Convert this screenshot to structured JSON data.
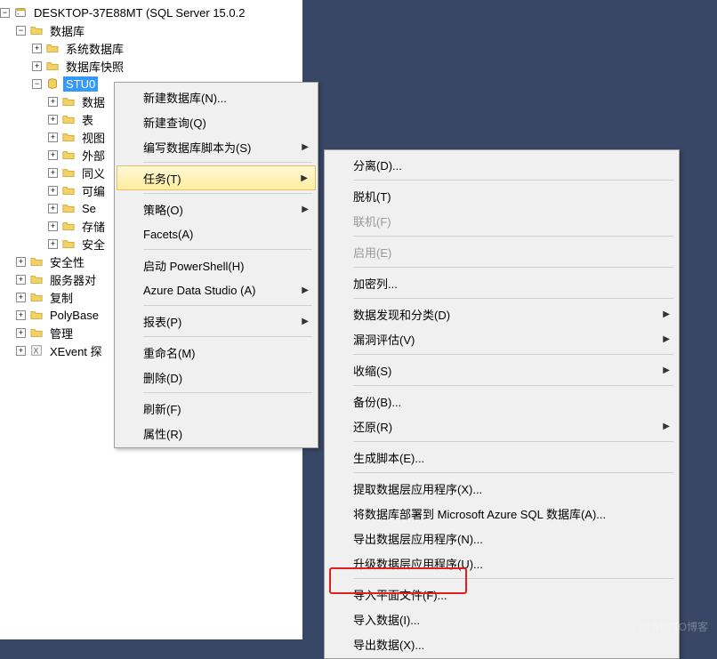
{
  "tree": {
    "root": "DESKTOP-37E88MT (SQL Server 15.0.2",
    "databases": "数据库",
    "sys_db": "系统数据库",
    "snapshot": "数据库快照",
    "selected_db": "STU0",
    "child_diagrams": "数据",
    "child_tables": "表",
    "child_views": "视图",
    "child_ext": "外部",
    "child_syn": "同义",
    "child_prog": "可编",
    "child_sec": "Se",
    "child_store": "存储",
    "child_sec2": "安全",
    "security": "安全性",
    "server_obj": "服务器对",
    "replication": "复制",
    "polybase": "PolyBase",
    "management": "管理",
    "xevent": "XEvent 探"
  },
  "menu1": {
    "new_db": "新建数据库(N)...",
    "new_query": "新建查询(Q)",
    "script_as": "编写数据库脚本为(S)",
    "tasks": "任务(T)",
    "policies": "策略(O)",
    "facets": "Facets(A)",
    "powershell": "启动 PowerShell(H)",
    "azure_ds": "Azure Data Studio (A)",
    "reports": "报表(P)",
    "rename": "重命名(M)",
    "delete": "删除(D)",
    "refresh": "刷新(F)",
    "properties": "属性(R)"
  },
  "menu2": {
    "detach": "分离(D)...",
    "offline": "脱机(T)",
    "online": "联机(F)",
    "enable": "启用(E)",
    "encrypt": "加密列...",
    "discover": "数据发现和分类(D)",
    "vuln": "漏洞评估(V)",
    "shrink": "收缩(S)",
    "backup": "备份(B)...",
    "restore": "还原(R)",
    "genscript": "生成脚本(E)...",
    "extract": "提取数据层应用程序(X)...",
    "deploy_azure": "将数据库部署到 Microsoft Azure SQL 数据库(A)...",
    "export_dacpac": "导出数据层应用程序(N)...",
    "upgrade_dacpac": "升级数据层应用程序(U)...",
    "import_flat": "导入平面文件(F)...",
    "import_data": "导入数据(I)...",
    "export_data": "导出数据(X)..."
  },
  "watermark": "@ 51CTO博客"
}
